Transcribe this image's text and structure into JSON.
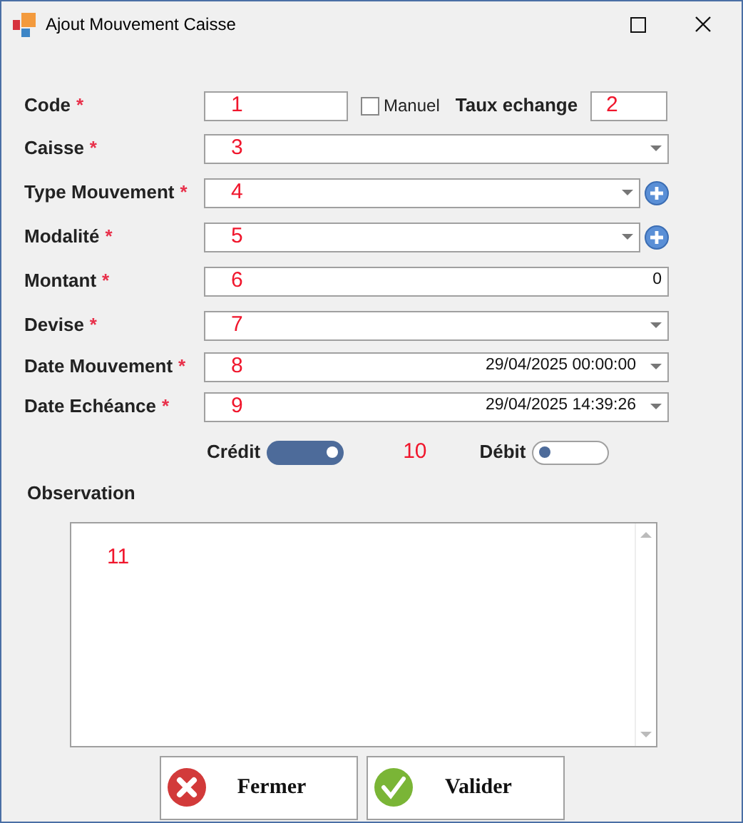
{
  "window": {
    "title": "Ajout Mouvement Caisse"
  },
  "code_row": {
    "label": "Code",
    "required_mark": "*",
    "annotation": "1",
    "manuel": {
      "label": "Manuel",
      "checked": false
    },
    "taux": {
      "label": "Taux echange",
      "annotation": "2"
    }
  },
  "fields": [
    {
      "label": "Caisse",
      "required_mark": "*",
      "kind": "combo",
      "annotation": "3"
    },
    {
      "label": "Type Mouvement",
      "required_mark": "*",
      "kind": "combo_add",
      "annotation": "4"
    },
    {
      "label": "Modalité",
      "required_mark": "*",
      "kind": "combo_add",
      "annotation": "5"
    },
    {
      "label": "Montant",
      "required_mark": "*",
      "kind": "number",
      "annotation": "6",
      "value": "0"
    },
    {
      "label": "Devise",
      "required_mark": "*",
      "kind": "combo",
      "annotation": "7"
    },
    {
      "label": "Date Mouvement",
      "required_mark": "*",
      "kind": "datetime",
      "annotation": "8",
      "value": "29/04/2025 00:00:00"
    },
    {
      "label": "Date Echéance",
      "required_mark": "*",
      "kind": "datetime",
      "annotation": "9",
      "value": "29/04/2025 14:39:26"
    }
  ],
  "sens": {
    "annotation": "10",
    "toggles": [
      {
        "label": "Crédit",
        "on": true
      },
      {
        "label": "Débit",
        "on": false
      }
    ]
  },
  "observation": {
    "label": "Observation",
    "annotation": "11"
  },
  "buttons": [
    {
      "label": "Fermer",
      "kind": "close"
    },
    {
      "label": "Valider",
      "kind": "validate"
    }
  ]
}
